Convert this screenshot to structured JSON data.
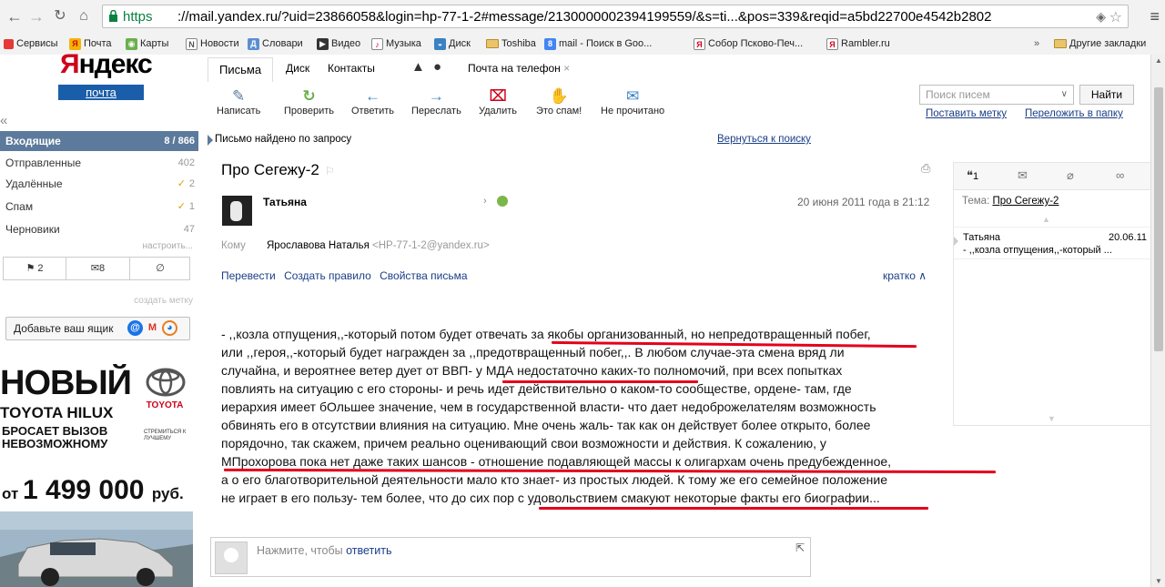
{
  "browser": {
    "url_https": "https",
    "url_rest": "://mail.yandex.ru/?uid=23866058&login=hp-77-1-2#message/2130000002394199559/&s=ti...&pos=339&reqid=a5bd22700e4542b2802",
    "bookmarks": [
      {
        "label": "Сервисы"
      },
      {
        "label": "Почта"
      },
      {
        "label": "Карты"
      },
      {
        "label": "Новости"
      },
      {
        "label": "Словари"
      },
      {
        "label": "Видео"
      },
      {
        "label": "Музыка"
      },
      {
        "label": "Диск"
      },
      {
        "label": "Toshiba"
      },
      {
        "label": "mail - Поиск в Goo..."
      },
      {
        "label": "Собор Псково-Печ..."
      },
      {
        "label": "Rambler.ru"
      }
    ],
    "other_bookmarks": "Другие закладки",
    "more": "»"
  },
  "logo": {
    "word_ya": "Я",
    "word_rest": "ндекс",
    "mail": "почта"
  },
  "sidebar": {
    "collapse": "«",
    "folders": [
      {
        "name": "Входящие",
        "count": "8 / 866"
      },
      {
        "name": "Отправленные",
        "count": "402"
      },
      {
        "name": "Удалённые",
        "count": "2"
      },
      {
        "name": "Спам",
        "count": "1"
      },
      {
        "name": "Черновики",
        "count": "47"
      }
    ],
    "setup": "настроить...",
    "filters": {
      "flagged": "2",
      "unread": "8"
    },
    "create_label": "создать метку",
    "add_box": "Добавьте ваш ящик"
  },
  "ad": {
    "novy": "НОВЫЙ",
    "hilux": "TOYOTA HILUX",
    "bros1": "БРОСАЕТ ВЫЗОВ",
    "bros2": "НЕВОЗМОЖНОМУ",
    "brand": "TOYOTA",
    "strem": "СТРЕМИТЬСЯ К ЛУЧШЕМУ",
    "price_ot": "от ",
    "price": "1 499 000",
    "price_unit": "руб."
  },
  "tabs": [
    {
      "label": "Письма"
    },
    {
      "label": "Диск"
    },
    {
      "label": "Контакты"
    },
    {
      "label": "Почта на телефон"
    }
  ],
  "toolbar": [
    {
      "label": "Написать",
      "icon": "compose-icon"
    },
    {
      "label": "Проверить",
      "icon": "refresh-icon"
    },
    {
      "label": "Ответить",
      "icon": "reply-icon"
    },
    {
      "label": "Переслать",
      "icon": "forward-icon"
    },
    {
      "label": "Удалить",
      "icon": "trash-icon"
    },
    {
      "label": "Это спам!",
      "icon": "spam-icon"
    },
    {
      "label": "Не прочитано",
      "icon": "envelope-icon"
    }
  ],
  "search": {
    "placeholder": "Поиск писем",
    "button": "Найти",
    "put_label": "Поставить метку",
    "move_folder": "Переложить в папку"
  },
  "found": {
    "text": "Письмо найдено по запросу",
    "back": "Вернуться к поиску"
  },
  "message": {
    "subject": "Про Сегежу-2",
    "sender": "Татьяна",
    "date": "20 июня 2011 года в 21:12",
    "to_label": "Кому",
    "to_name": "Ярославова Наталья",
    "to_addr": "<HP-77-1-2@yandex.ru>",
    "actions": [
      "Перевести",
      "Создать правило",
      "Свойства письма"
    ],
    "brief": "кратко",
    "body": [
      "- ,,козла отпущения,,-который потом будет отвечать за якобы организованный, но непредотвращенный побег,",
      "или ,,героя,,-который будет награжден за ,,предотвращенный побег,,. В любом случае-эта смена вряд ли",
      "случайна, и вероятнее ветер дует от ВВП- у МДА недостаточно каких-то полномочий, при всех попытках",
      "повлиять на ситуацию с его стороны- и речь идет действительно о каком-то сообществе, ордене- там, где",
      "иерархия имеет бОльшее значение, чем в государственной власти- что дает недоброжелателям возможность",
      "обвинять его в отсутствии влияния на ситуацию. Мне очень жаль- так как он действует более открыто, более",
      "порядочно, так скажем, причем реально оценивающий свои возможности и действия. К сожалению, у",
      "МПрохорова пока нет даже таких шансов - отношение подавляющей массы к олигархам очень предубежденное,",
      "а о его благотворительной деятельности мало кто знает- из простых людей. К тому же его семейное положение",
      "не играет в его пользу- тем более, что до сих пор с удовольствием смакуют некоторые факты его биографии..."
    ]
  },
  "reply": {
    "prefix": "Нажмите, чтобы ",
    "link": "ответить"
  },
  "thread": {
    "count": "1",
    "topic_label": "Тема: ",
    "topic": "Про Сегежу-2",
    "who": "Татьяна",
    "date": "20.06.11",
    "preview": "- ,,козла отпущения,,-который ..."
  },
  "colors": {
    "accent": "#5c7a9b",
    "link": "#1a3e87",
    "underline_red": "#e3001b",
    "yandex_red": "#d0021b"
  }
}
